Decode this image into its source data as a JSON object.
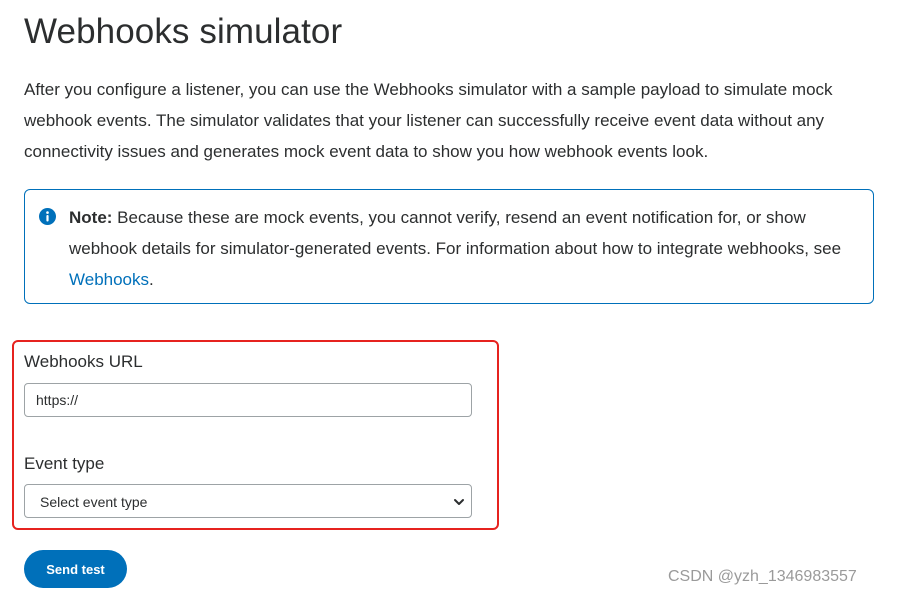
{
  "page": {
    "title": "Webhooks simulator",
    "intro": "After you configure a listener, you can use the Webhooks simulator with a sample payload to simulate mock webhook events. The simulator validates that your listener can successfully receive event data without any connectivity issues and generates mock event data to show you how webhook events look."
  },
  "note": {
    "icon": "info-icon",
    "label": "Note:",
    "text_before_link": " Because these are mock events, you cannot verify, resend an event notification for, or show webhook details for simulator-generated events. For information about how to integrate webhooks, see ",
    "link_text": "Webhooks",
    "text_after_link": "."
  },
  "form": {
    "url_label": "Webhooks URL",
    "url_value": "https://",
    "event_label": "Event type",
    "event_selected": "Select event type",
    "event_icon": "chevron-down-icon"
  },
  "actions": {
    "send_label": "Send test"
  },
  "watermark": "CSDN @yzh_1346983557",
  "colors": {
    "accent": "#0070ba",
    "highlight": "#e6231f",
    "text": "#2c2e2f"
  }
}
